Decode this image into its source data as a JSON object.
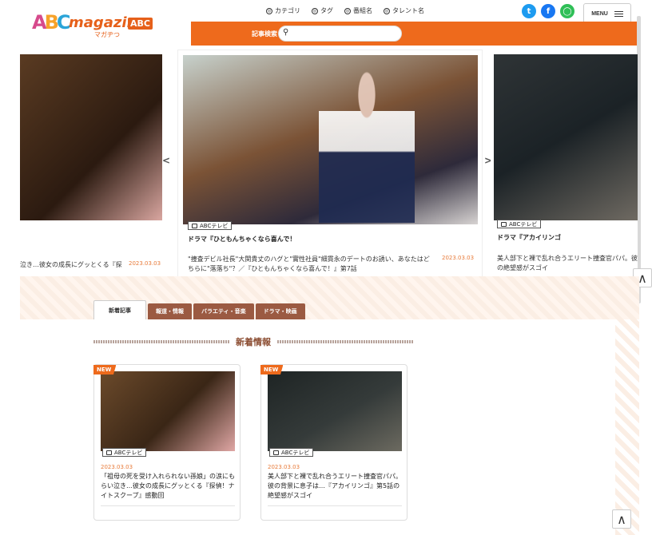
{
  "header": {
    "logo": {
      "cube": [
        "A",
        "B",
        "C"
      ],
      "text": "magazine",
      "abc": "ABC",
      "sub": "マガヂつ"
    },
    "nav": [
      {
        "label": "カテゴリ",
        "icon": "category-icon"
      },
      {
        "label": "タグ",
        "icon": "tag-icon"
      },
      {
        "label": "番組名",
        "icon": "program-icon"
      },
      {
        "label": "タレント名",
        "icon": "talent-icon"
      }
    ],
    "search": {
      "label": "記事検索",
      "placeholder": ""
    },
    "social": [
      "twitter-icon",
      "facebook-icon",
      "line-icon"
    ],
    "menu_label": "MENU"
  },
  "carousel": {
    "left": {
      "tag": "",
      "desc": "泣き…彼女の成長にグッとくる『探",
      "date": "2023.03.03"
    },
    "center": {
      "tag": "ABCテレビ",
      "title": "ドラマ『ひともんちゃくなら喜んで！",
      "desc": "\"捜査デビル社長\"大関貴丈のハグと\"實性社員\"細貫永のデートのお誘い、あなたはどちらに\"落落ち\"？／『ひともんちゃくなら喜んで！』第7話",
      "date": "2023.03.03"
    },
    "right": {
      "tag": "ABCテレビ",
      "title": "ドラマ『アカイリンゴ",
      "desc": "美人部下と裸で乱れ合うエリート捜査官パパ。彼の絶望感がスゴイ"
    }
  },
  "tabs": [
    {
      "label": "新着記事",
      "active": true
    },
    {
      "label": "報道・情報",
      "active": false
    },
    {
      "label": "バラエティ・音楽",
      "active": false
    },
    {
      "label": "ドラマ・映画",
      "active": false
    }
  ],
  "section_title": "新着情報",
  "news": [
    {
      "badge": "NEW",
      "tag": "ABCテレビ",
      "date": "2023.03.03",
      "title": "「祖母の死を受け入れられない孫娘」の涙にもらい泣き…彼女の成長にグッとくる『探偵！ナイトスクープ』感動回"
    },
    {
      "badge": "NEW",
      "tag": "ABCテレビ",
      "date": "2023.03.03",
      "title": "美人部下と裸で乱れ合うエリート捜査官パパ。彼の背景に息子は…『アカイリンゴ』第5話の絶望感がスゴイ"
    }
  ],
  "up_symbol": "∧",
  "arrows": {
    "prev": "<",
    "next": ">"
  }
}
